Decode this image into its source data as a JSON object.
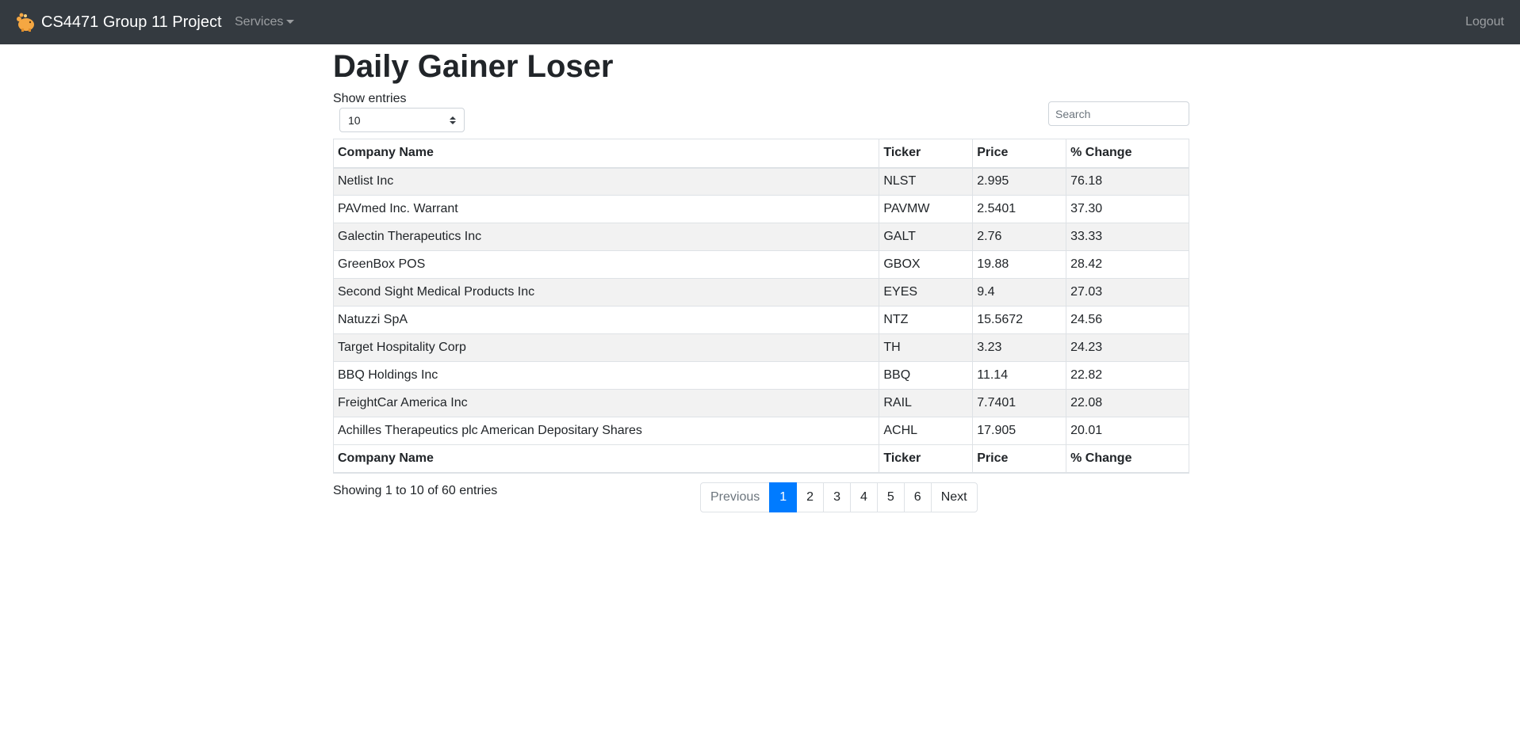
{
  "navbar": {
    "brand": "CS4471 Group 11 Project",
    "brand_icon": "piggy-bank-icon",
    "services_label": "Services",
    "logout_label": "Logout"
  },
  "page": {
    "title": "Daily Gainer Loser"
  },
  "controls": {
    "length_label": "Show entries",
    "length_value": "10",
    "search_placeholder": "Search"
  },
  "table": {
    "columns": [
      "Company Name",
      "Ticker",
      "Price",
      "% Change"
    ],
    "rows": [
      [
        "Netlist Inc",
        "NLST",
        "2.995",
        "76.18"
      ],
      [
        "PAVmed Inc. Warrant",
        "PAVMW",
        "2.5401",
        "37.30"
      ],
      [
        "Galectin Therapeutics Inc",
        "GALT",
        "2.76",
        "33.33"
      ],
      [
        "GreenBox POS",
        "GBOX",
        "19.88",
        "28.42"
      ],
      [
        "Second Sight Medical Products Inc",
        "EYES",
        "9.4",
        "27.03"
      ],
      [
        "Natuzzi SpA",
        "NTZ",
        "15.5672",
        "24.56"
      ],
      [
        "Target Hospitality Corp",
        "TH",
        "3.23",
        "24.23"
      ],
      [
        "BBQ Holdings Inc",
        "BBQ",
        "11.14",
        "22.82"
      ],
      [
        "FreightCar America Inc",
        "RAIL",
        "7.7401",
        "22.08"
      ],
      [
        "Achilles Therapeutics plc American Depositary Shares",
        "ACHL",
        "17.905",
        "20.01"
      ]
    ]
  },
  "footer": {
    "info": "Showing 1 to 10 of 60 entries",
    "pagination": {
      "previous": "Previous",
      "pages": [
        "1",
        "2",
        "3",
        "4",
        "5",
        "6"
      ],
      "next": "Next",
      "active_page": "1"
    }
  },
  "colors": {
    "navbar_bg": "#343a40",
    "active_page_bg": "#007bff",
    "striped_row_bg": "#f2f2f2"
  }
}
